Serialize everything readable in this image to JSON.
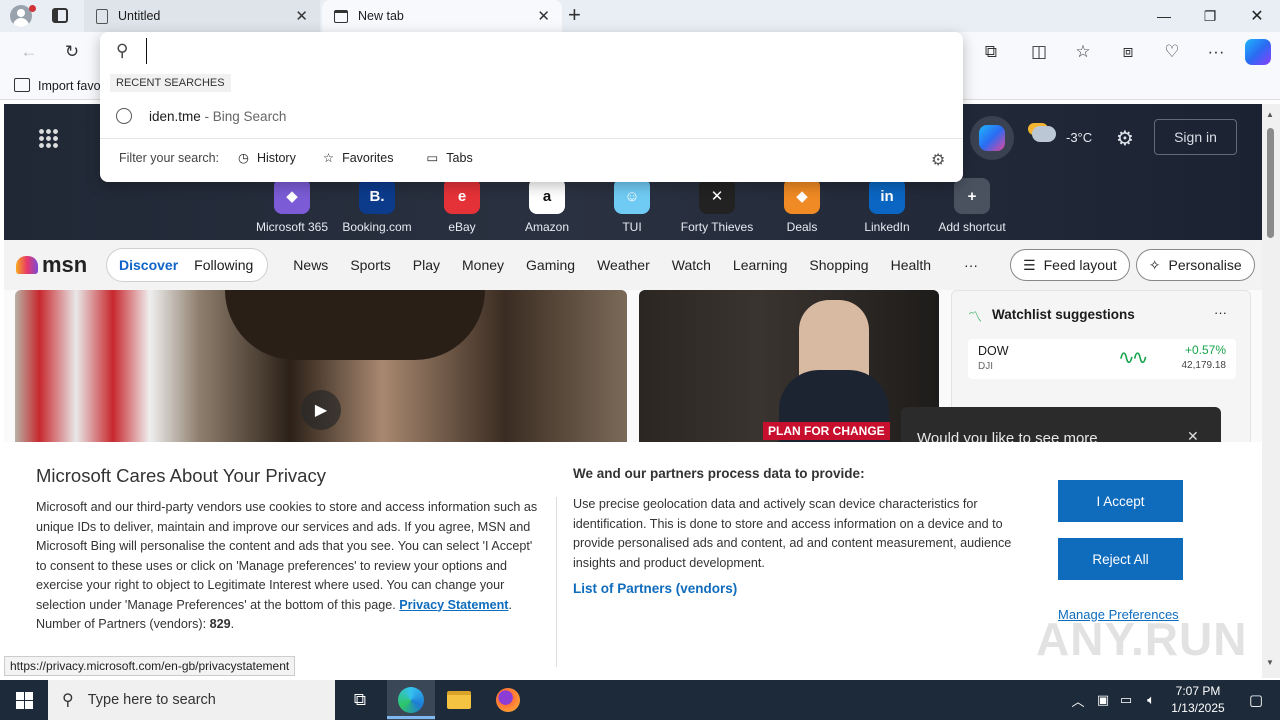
{
  "browser": {
    "tabs": [
      {
        "title": "Untitled"
      },
      {
        "title": "New tab"
      }
    ],
    "new_tab": "+",
    "address_value": "",
    "favorites_bar": {
      "import_label": "Import favo"
    }
  },
  "omnibox": {
    "recent_header": "RECENT SEARCHES",
    "recent_item": "iden.tme",
    "recent_item_suffix": " - Bing Search",
    "filter_label": "Filter your search:",
    "filters": [
      "History",
      "Favorites",
      "Tabs"
    ]
  },
  "newtab": {
    "weather": "-3°C",
    "sign_in": "Sign in",
    "shortcuts": [
      {
        "label": "Microsoft 365",
        "color": "#7b5cd6",
        "glyph": "◆"
      },
      {
        "label": "Booking.com",
        "color": "#0c3b8c",
        "glyph": "B."
      },
      {
        "label": "eBay",
        "color": "#e53238",
        "glyph": "e"
      },
      {
        "label": "Amazon",
        "color": "#ffffff",
        "glyph": "a"
      },
      {
        "label": "TUI",
        "color": "#70cbf4",
        "glyph": "☺"
      },
      {
        "label": "Forty Thieves",
        "color": "#222222",
        "glyph": "✕"
      },
      {
        "label": "Deals",
        "color": "#f08a24",
        "glyph": "◆"
      },
      {
        "label": "LinkedIn",
        "color": "#0a66c2",
        "glyph": "in"
      },
      {
        "label": "Add shortcut",
        "color": "#4a5260",
        "glyph": "+"
      }
    ]
  },
  "msn": {
    "logo": "msn",
    "tabs": [
      "Discover",
      "Following"
    ],
    "nav": [
      "News",
      "Sports",
      "Play",
      "Money",
      "Gaming",
      "Weather",
      "Watch",
      "Learning",
      "Shopping",
      "Health"
    ],
    "more": "···",
    "feed_layout": "Feed layout",
    "personalise": "Personalise",
    "card_badge": "PLAN FOR CHANGE",
    "watchlist": {
      "title": "Watchlist suggestions",
      "symbol": "DOW",
      "exchange": "DJI",
      "change": "+0.57%",
      "price": "42,179.18"
    },
    "toast": "Would you like to see more"
  },
  "consent": {
    "title": "Microsoft Cares About Your Privacy",
    "body": "Microsoft and our third-party vendors use cookies to store and access information such as unique IDs to deliver, maintain and improve our services and ads. If you agree, MSN and Microsoft Bing will personalise the content and ads that you see. You can select 'I Accept' to consent to these uses or click on 'Manage preferences' to review your options and exercise your right to object to Legitimate Interest where used.  You can change your selection under 'Manage Preferences' at the bottom of this page.",
    "privacy_link": "Privacy Statement",
    "partners_label": "Number of Partners (vendors): ",
    "partners_count": "829",
    "right_title": "We and our partners process data to provide:",
    "right_body": "Use precise geolocation data and actively scan device characteristics for identification. This is done to store and access information on a device and to provide personalised ads and content, ad and content measurement, audience insights and product development.",
    "partners_link": "List of Partners (vendors)",
    "accept": "I Accept",
    "reject": "Reject All",
    "manage": "Manage Preferences"
  },
  "status_url": "https://privacy.microsoft.com/en-gb/privacystatement",
  "watermark": "ANY.RUN",
  "taskbar": {
    "search_placeholder": "Type here to search",
    "time": "7:07 PM",
    "date": "1/13/2025"
  }
}
